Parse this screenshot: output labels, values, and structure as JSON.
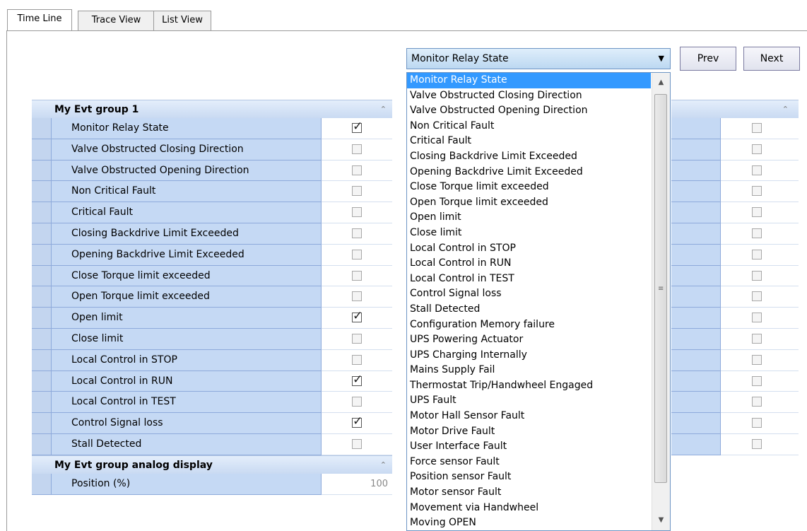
{
  "tabs": [
    {
      "label": "Time Line",
      "active": true
    },
    {
      "label": "Trace View",
      "active": false
    },
    {
      "label": "List View",
      "active": false
    }
  ],
  "selector": {
    "selected": "Monitor Relay State",
    "prev_label": "Prev",
    "next_label": "Next"
  },
  "dropdown_options": [
    "Monitor Relay State",
    "Valve Obstructed Closing Direction",
    "Valve Obstructed Opening Direction",
    "Non Critical Fault",
    "Critical Fault",
    "Closing Backdrive Limit Exceeded",
    "Opening Backdrive Limit Exceeded",
    "Close Torque limit exceeded",
    "Open Torque limit exceeded",
    "Open  limit",
    "Close limit",
    "Local Control in STOP",
    "Local Control in RUN",
    "Local Control in TEST",
    "Control Signal loss",
    "Stall Detected",
    "Configuration Memory failure",
    "UPS Powering Actuator",
    "UPS Charging Internally",
    "Mains Supply Fail",
    "Thermostat Trip/Handwheel Engaged",
    "UPS Fault",
    "Motor Hall Sensor Fault",
    "Motor Drive Fault",
    "User Interface Fault",
    "Force sensor Fault",
    "Position sensor Fault",
    "Motor sensor Fault",
    "Movement via Handwheel",
    "Moving OPEN"
  ],
  "group1": {
    "title": "My Evt group 1",
    "rows": [
      {
        "label": "Monitor Relay State",
        "checked": true
      },
      {
        "label": "Valve Obstructed Closing Direction",
        "checked": false
      },
      {
        "label": "Valve Obstructed Opening Direction",
        "checked": false
      },
      {
        "label": "Non Critical Fault",
        "checked": false
      },
      {
        "label": "Critical Fault",
        "checked": false
      },
      {
        "label": "Closing Backdrive Limit Exceeded",
        "checked": false
      },
      {
        "label": "Opening Backdrive Limit Exceeded",
        "checked": false
      },
      {
        "label": "Close Torque limit exceeded",
        "checked": false
      },
      {
        "label": "Open Torque limit exceeded",
        "checked": false
      },
      {
        "label": "Open  limit",
        "checked": true
      },
      {
        "label": "Close limit",
        "checked": false
      },
      {
        "label": "Local Control in STOP",
        "checked": false
      },
      {
        "label": "Local Control in RUN",
        "checked": true
      },
      {
        "label": "Local Control in TEST",
        "checked": false
      },
      {
        "label": "Control Signal loss",
        "checked": true
      },
      {
        "label": "Stall Detected",
        "checked": false
      }
    ]
  },
  "group2": {
    "title": "My Evt group analog display",
    "rows": [
      {
        "label": "Position (%)",
        "value": "100"
      }
    ]
  },
  "right_grid_rows": [
    false,
    false,
    false,
    false,
    false,
    false,
    false,
    false,
    false,
    false,
    false,
    false,
    false,
    false,
    false,
    false
  ],
  "icons": {
    "collapse": "chevron-up-icon",
    "dropdown": "chevron-down-icon"
  }
}
